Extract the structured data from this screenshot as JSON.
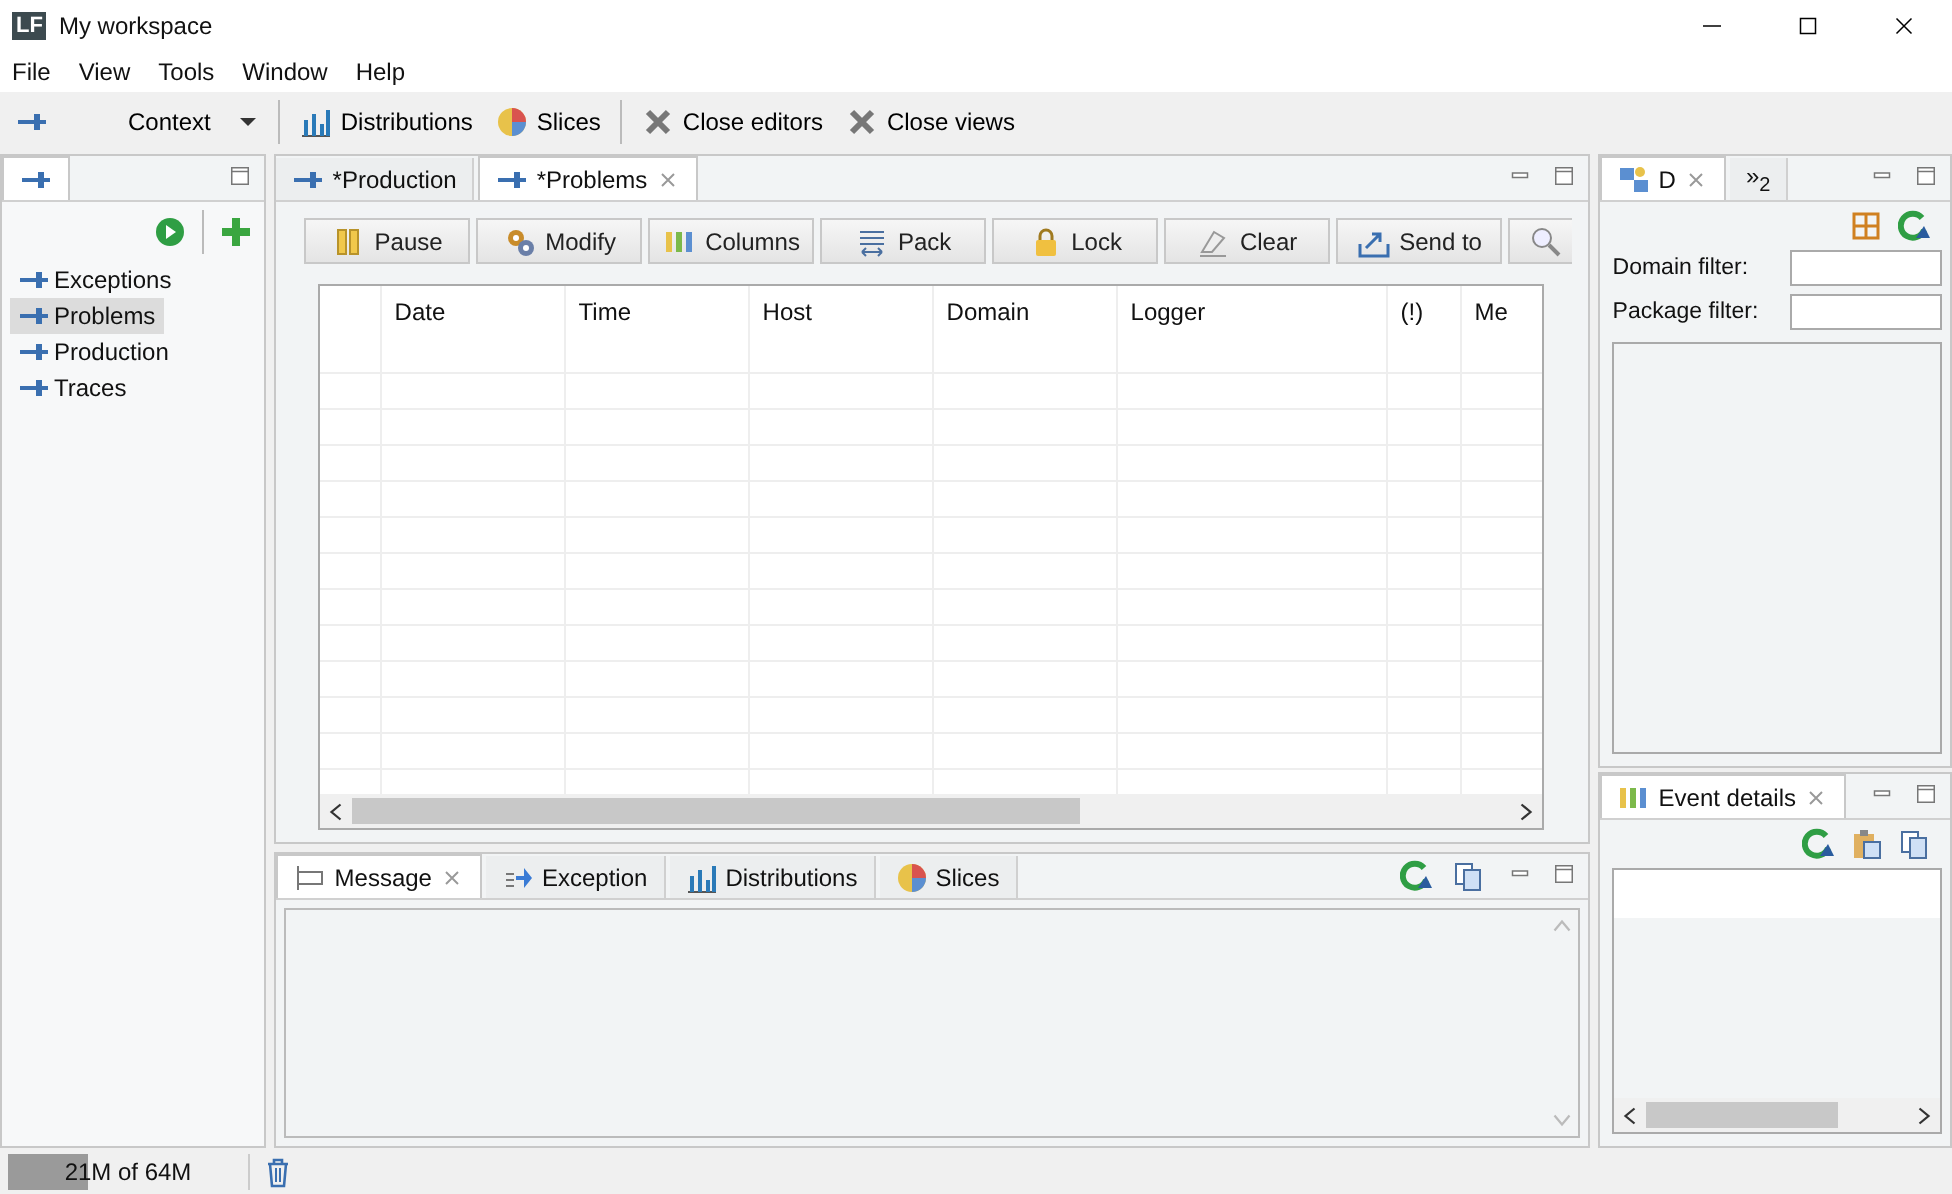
{
  "window": {
    "logo": "LF",
    "title": "My workspace"
  },
  "menu": [
    "File",
    "View",
    "Tools",
    "Window",
    "Help"
  ],
  "toolbar": [
    {
      "kind": "icon"
    },
    {
      "kind": "dropdown",
      "label": "Context"
    },
    {
      "kind": "button",
      "label": "Distributions"
    },
    {
      "kind": "button",
      "label": "Slices"
    },
    {
      "kind": "button",
      "label": "Close editors"
    },
    {
      "kind": "button",
      "label": "Close views"
    }
  ],
  "logs_panel": {
    "items": [
      {
        "label": "Exceptions",
        "selected": false
      },
      {
        "label": "Problems",
        "selected": true
      },
      {
        "label": "Production",
        "selected": false
      },
      {
        "label": "Traces",
        "selected": false
      }
    ]
  },
  "editor": {
    "tabs": [
      {
        "label": "*Production",
        "selected": false,
        "closable": false
      },
      {
        "label": "*Problems",
        "selected": true,
        "closable": true
      }
    ],
    "actions": [
      {
        "kind": "button",
        "label": "Pause"
      },
      {
        "kind": "button",
        "label": "Modify"
      },
      {
        "kind": "button",
        "label": "Columns"
      },
      {
        "kind": "button",
        "label": "Pack"
      },
      {
        "kind": "button",
        "label": "Lock"
      },
      {
        "kind": "button",
        "label": "Clear"
      },
      {
        "kind": "button",
        "label": "Send to"
      },
      {
        "kind": "icon"
      }
    ],
    "table": {
      "columns": [
        "Date",
        "Time",
        "Host",
        "Domain",
        "Logger",
        "(!)",
        "Me"
      ]
    }
  },
  "bottom_panel": {
    "tabs": [
      {
        "label": "Message",
        "selected": true,
        "closable": true
      },
      {
        "label": "Exception",
        "selected": false,
        "closable": false
      },
      {
        "label": "Distributions",
        "selected": false,
        "closable": false
      },
      {
        "label": "Slices",
        "selected": false,
        "closable": false
      }
    ]
  },
  "filter_panel": {
    "tabs": [
      {
        "label": "D",
        "selected": true,
        "closable": true
      },
      {
        "label": "»$_{2}$",
        "selected": false,
        "closable": false
      }
    ],
    "fields": [
      {
        "label": "Domain filter:"
      },
      {
        "label": "Package filter:"
      }
    ]
  },
  "details_panel": {
    "tabs": [
      {
        "label": "Event details",
        "selected": true,
        "closable": true
      }
    ]
  },
  "status_bar": {
    "memory": "21M of 64M",
    "level": 0.33
  }
}
